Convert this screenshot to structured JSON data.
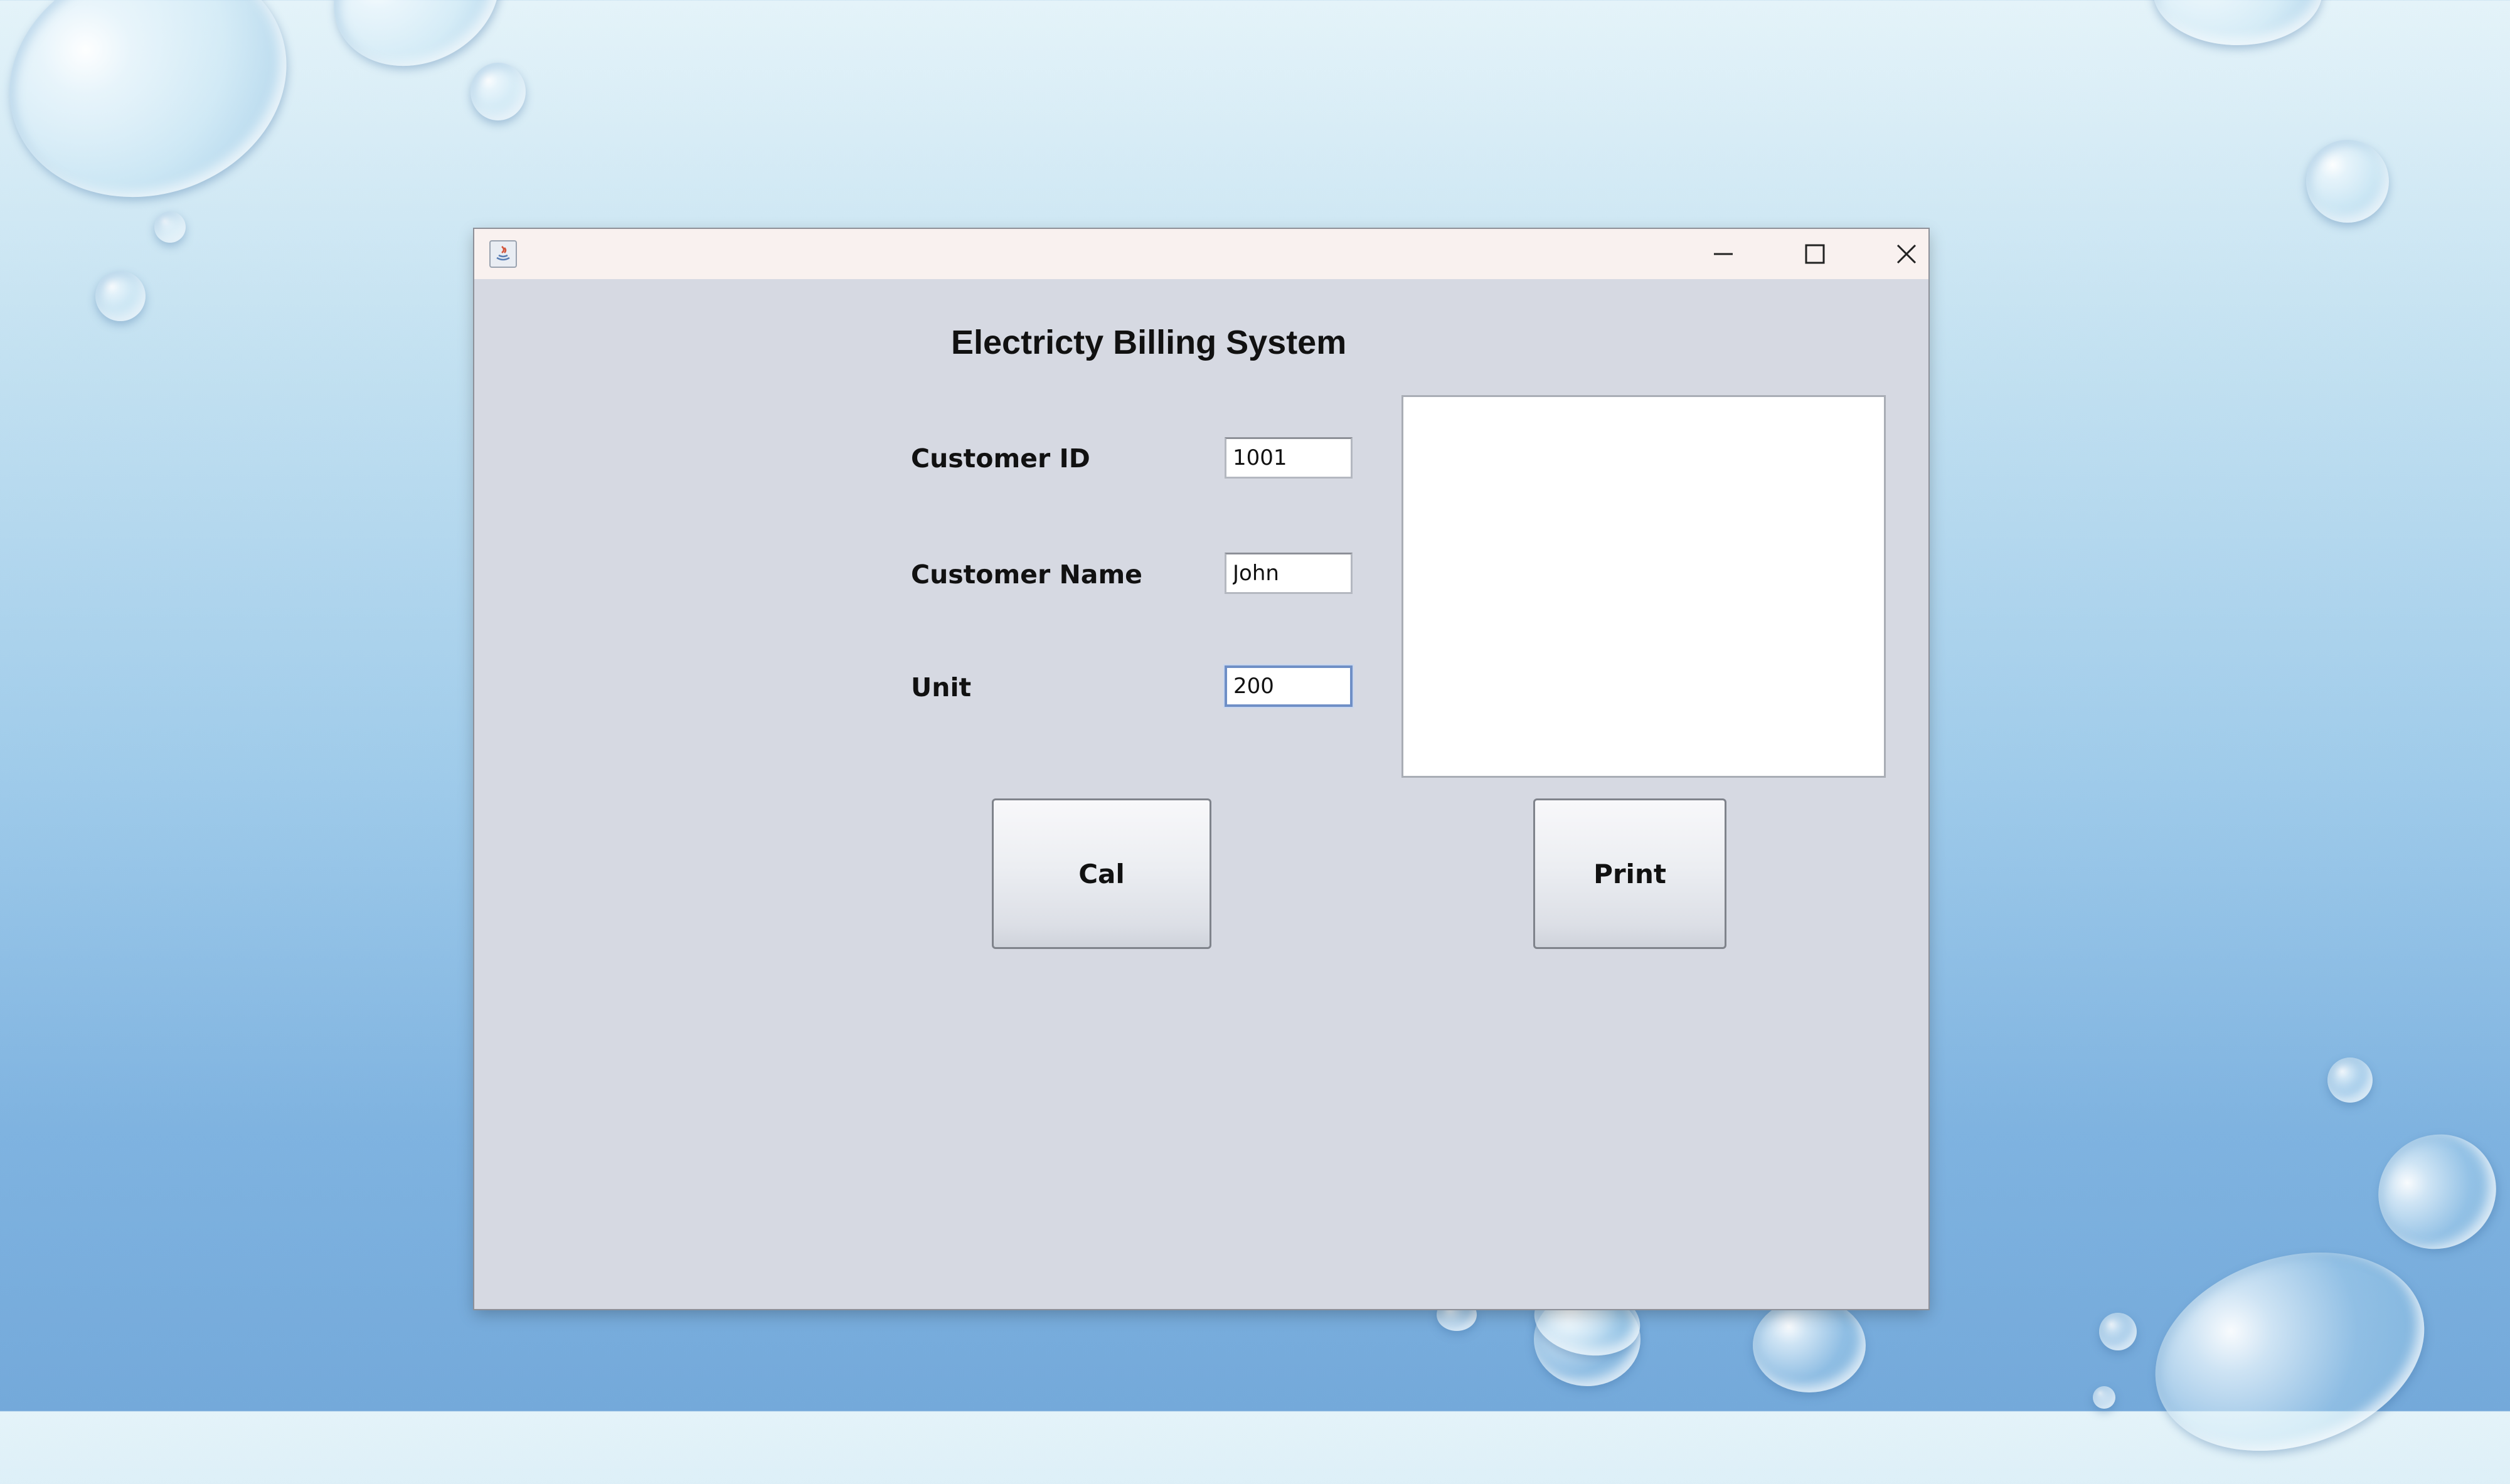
{
  "window": {
    "heading": "Electricty Billing System",
    "controls": {
      "minimize_icon": "minimize-icon",
      "maximize_icon": "maximize-icon",
      "close_icon": "close-icon"
    }
  },
  "form": {
    "customer_id": {
      "label": "Customer ID",
      "value": "1001"
    },
    "customer_name": {
      "label": "Customer Name",
      "value": "John"
    },
    "unit": {
      "label": "Unit",
      "value": "200"
    }
  },
  "output_area": {
    "value": ""
  },
  "buttons": {
    "cal_label": "Cal",
    "print_label": "Print"
  },
  "colors": {
    "window_background": "#d6d9e2",
    "titlebar_background": "#f9f1ef",
    "focus_border": "#6f8fc6"
  }
}
